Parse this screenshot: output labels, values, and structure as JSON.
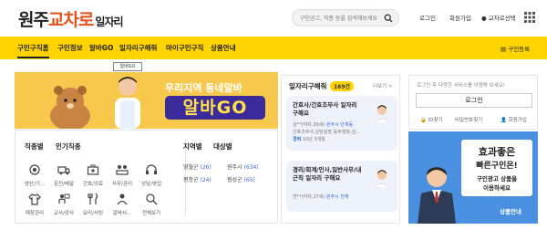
{
  "header": {
    "logo_main": "원주",
    "logo_accent": "교차로",
    "logo_sub": "일자리",
    "search_placeholder": "구인공고, 직종 등을 검색해보세요",
    "links": [
      "로그인",
      "회원가입",
      "교차로선택"
    ]
  },
  "nav": {
    "items": [
      "구인구직홈",
      "구인정보",
      "알바GO",
      "일자리구해줘",
      "마이구인구직",
      "상품안내"
    ],
    "right": "구인등록"
  },
  "banner": {
    "bubble": "알바GO",
    "line1": "우리지역 동네알바",
    "line2": "알바GO"
  },
  "categories": {
    "tabs": [
      "직종별",
      "인기직종"
    ],
    "items": [
      "생산/기...",
      "운전/배달",
      "간호/의료",
      "사무/관리",
      "상담/영업",
      "매장관리",
      "교사/강사",
      "요리/서빙",
      "알바서...",
      "전체보기"
    ]
  },
  "regions": {
    "tabs": [
      "지역별",
      "대상별"
    ],
    "items": [
      {
        "name": "영월군",
        "count": "(26)"
      },
      {
        "name": "원주시",
        "count": "(634)"
      },
      {
        "name": "평창군",
        "count": "(24)"
      },
      {
        "name": "횡성군",
        "count": "(65)"
      }
    ]
  },
  "recommend": {
    "title": "일자리구해줘",
    "badge": "169건",
    "more": "더보기 >",
    "cards": [
      {
        "title": "간호사/간호조무사 일자리 구해요",
        "name": "김**",
        "age": "(여자,39세)",
        "location": "원주시 단계동",
        "detail": "간호조무사,상담실장,동무행정,심...",
        "pay_label": "경력",
        "pay_value": "10년 3개월"
      },
      {
        "title": "경리/회계/인사,일반사무/내근직 일자리 구해요",
        "name": "연**",
        "age": "(여자,27세)",
        "location": "원주시 전체"
      }
    ]
  },
  "login": {
    "message": "로그인 후 다양한 서비스를 이용해 보세요!",
    "button": "로그인",
    "links": [
      "ID찾기",
      "비밀번호찾기",
      "회원가입"
    ]
  },
  "ad": {
    "line1": "효과좋은",
    "line2": "빠른구인은!",
    "line3": "구인광고 상품을",
    "line4": "이용하세요",
    "link": "상품안내"
  },
  "colors": {
    "brand_yellow": "#ffd400",
    "accent_orange": "#e8501a",
    "link_blue": "#3b6cd4",
    "ad_blue": "#4a8fe0"
  }
}
